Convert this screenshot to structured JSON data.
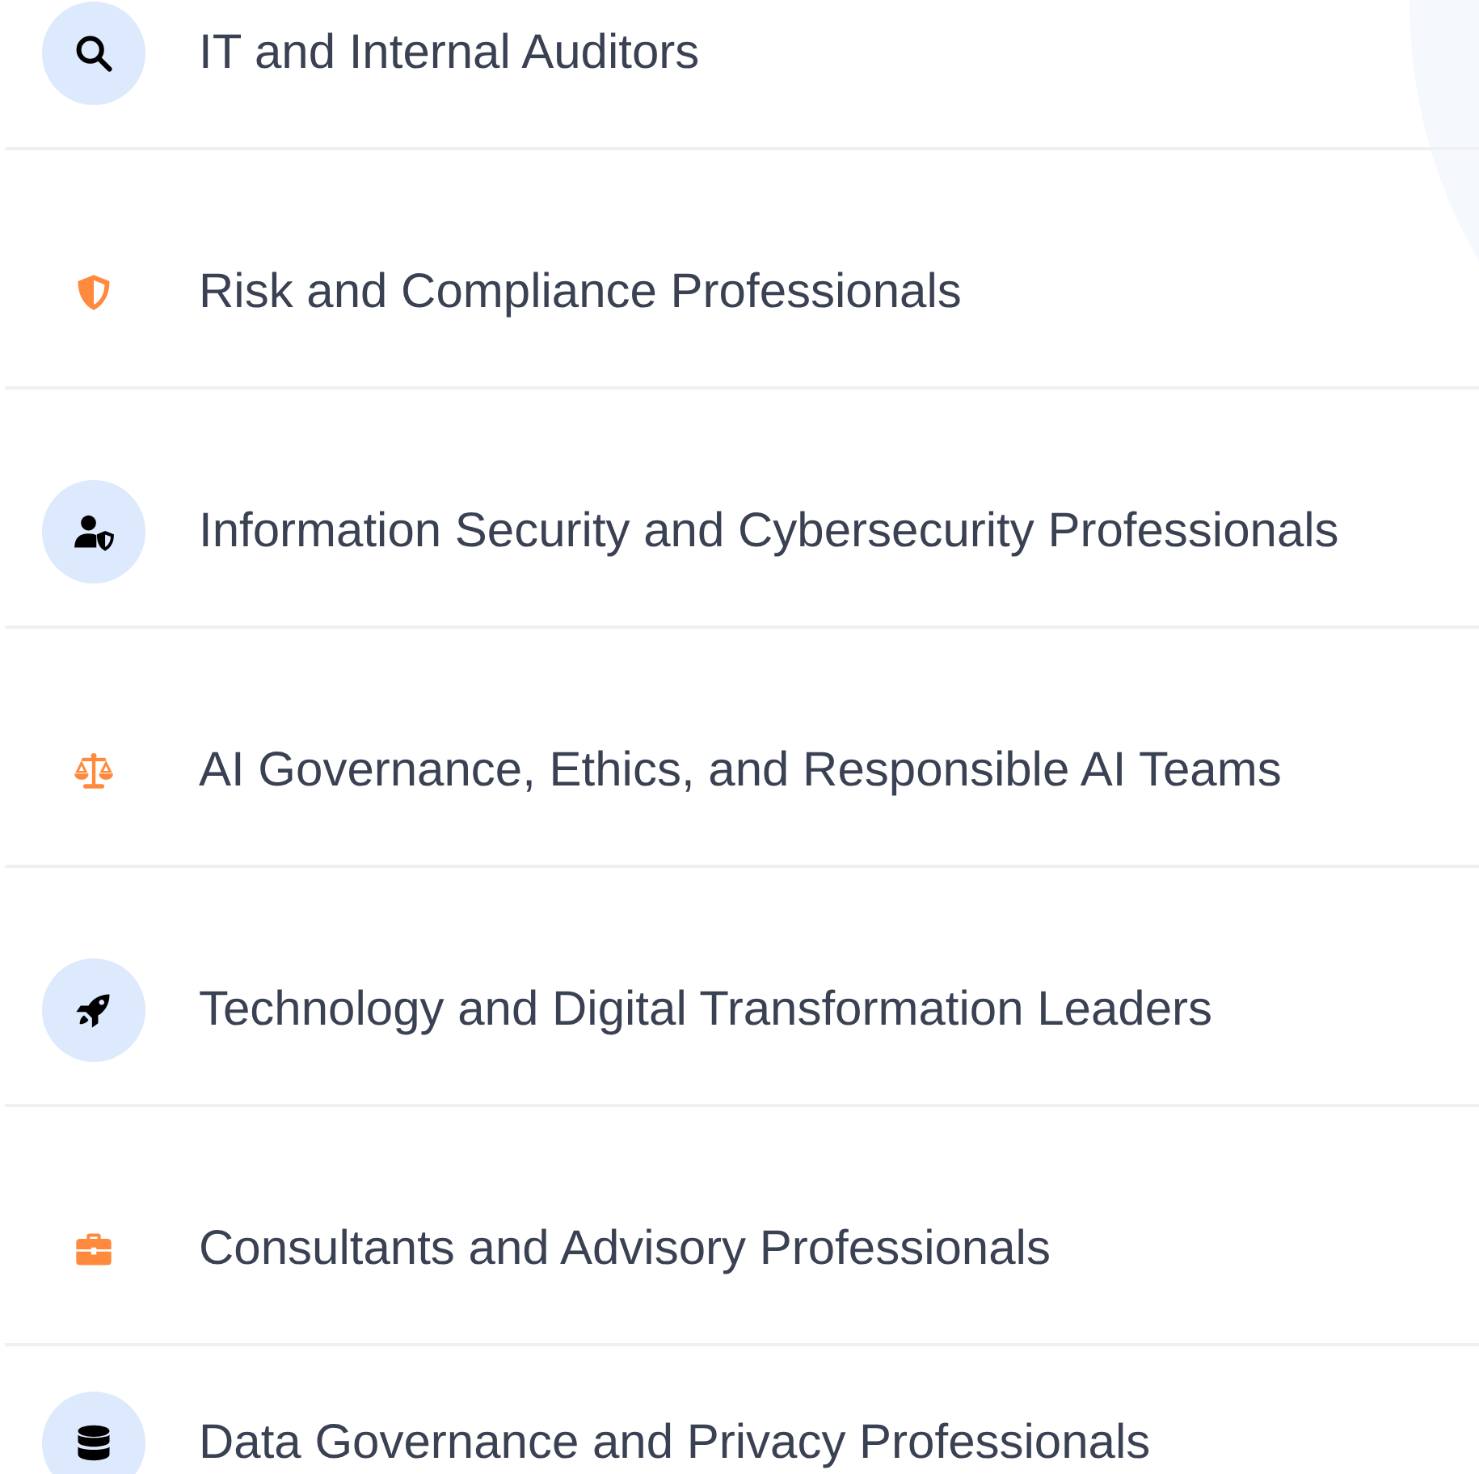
{
  "audiences": [
    {
      "label": "IT and Internal Auditors",
      "kind": "circled"
    },
    {
      "label": "Risk and Compliance Professionals",
      "kind": "plain"
    },
    {
      "label": "Information Security and Cybersecurity Professionals",
      "kind": "circled"
    },
    {
      "label": "AI Governance, Ethics, and Responsible AI Teams",
      "kind": "plain"
    },
    {
      "label": "Technology and Digital Transformation Leaders",
      "kind": "circled"
    },
    {
      "label": "Consultants and Advisory Professionals",
      "kind": "plain"
    },
    {
      "label": "Data Governance and Privacy Professionals",
      "kind": "circled"
    }
  ]
}
